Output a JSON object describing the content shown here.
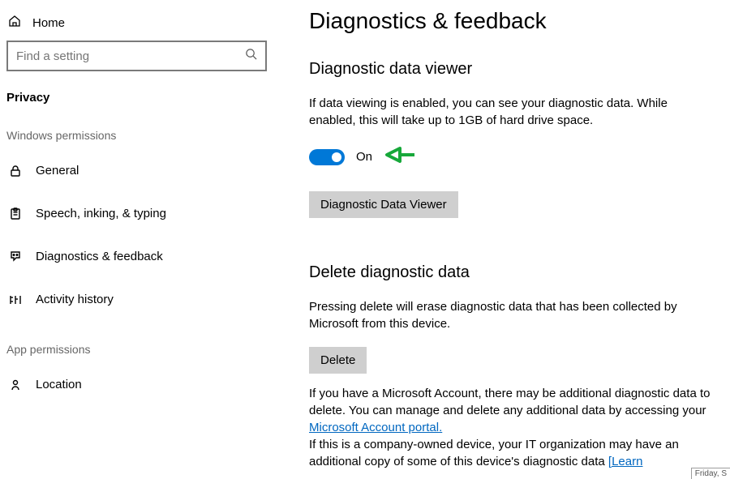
{
  "sidebar": {
    "home_label": "Home",
    "search_placeholder": "Find a setting",
    "title": "Privacy",
    "group1_label": "Windows permissions",
    "items": [
      {
        "label": "General"
      },
      {
        "label": "Speech, inking, & typing"
      },
      {
        "label": "Diagnostics & feedback"
      },
      {
        "label": "Activity history"
      }
    ],
    "group2_label": "App permissions",
    "items2": [
      {
        "label": "Location"
      }
    ]
  },
  "main": {
    "title": "Diagnostics & feedback",
    "viewer": {
      "title": "Diagnostic data viewer",
      "desc": "If data viewing is enabled, you can see your diagnostic data. While enabled, this will take up to 1GB of hard drive space.",
      "toggle_label": "On",
      "button_label": "Diagnostic Data Viewer"
    },
    "delete": {
      "title": "Delete diagnostic data",
      "desc": "Pressing delete will erase diagnostic data that has been collected by Microsoft from this device.",
      "button_label": "Delete",
      "info_prefix": "If you have a Microsoft Account, there may be additional diagnostic data to delete. You can manage and delete any additional data by accessing your ",
      "link_text": "Microsoft Account portal.",
      "info2_prefix": "If this is a company-owned device, your IT organization may have an additional copy of some of this device's diagnostic data ",
      "link2_text": "[Learn"
    },
    "footer_badge": "Friday, S"
  }
}
